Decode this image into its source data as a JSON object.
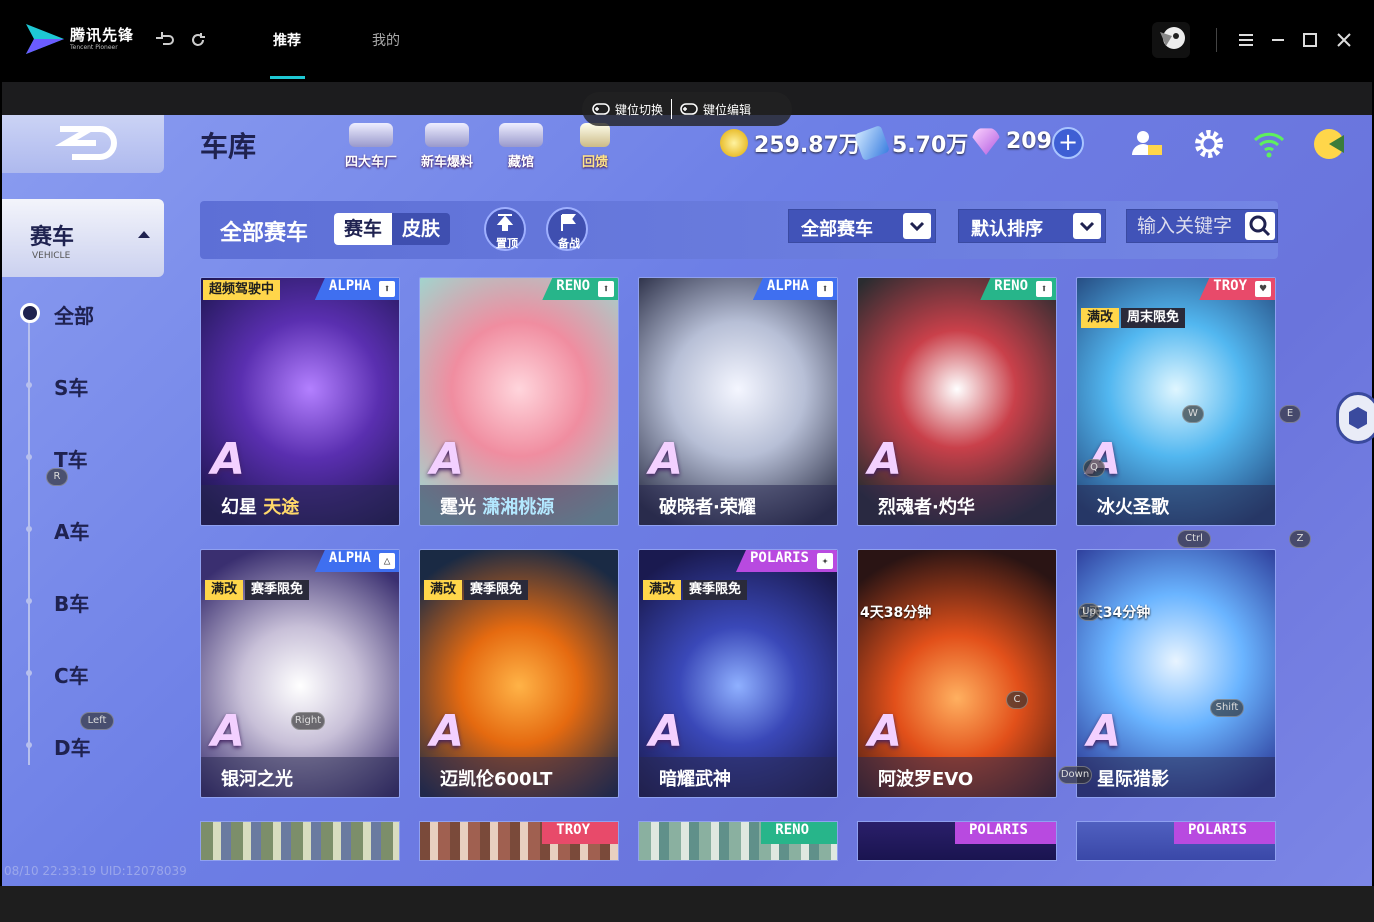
{
  "app": {
    "logo_cn": "腾讯先锋",
    "logo_en": "Tencent Pioneer",
    "tabs": [
      {
        "label": "推荐",
        "active": true
      },
      {
        "label": "我的",
        "active": false
      }
    ]
  },
  "keybar": {
    "switch_label": "键位切换",
    "edit_label": "键位编辑"
  },
  "game": {
    "title": "车库",
    "nav": [
      {
        "label": "四大车厂",
        "icon": "factory-icon"
      },
      {
        "label": "新车爆料",
        "icon": "new-car-icon"
      },
      {
        "label": "藏馆",
        "icon": "museum-icon"
      },
      {
        "label": "回馈",
        "icon": "gift-icon"
      }
    ],
    "currency": {
      "coins": "259.87万",
      "tickets": "5.70万",
      "gems": "209"
    },
    "sidebar": {
      "category_cn": "赛车",
      "category_en": "VEHICLE",
      "items": [
        {
          "label": "全部",
          "active": true
        },
        {
          "label": "S车"
        },
        {
          "label": "T车"
        },
        {
          "label": "A车"
        },
        {
          "label": "B车"
        },
        {
          "label": "C车"
        },
        {
          "label": "D车"
        }
      ]
    },
    "filter": {
      "title": "全部赛车",
      "seg_on": "赛车",
      "seg_off": "皮肤",
      "pin_label": "置顶",
      "backup_label": "备战",
      "dropdown_type": "全部赛车",
      "dropdown_sort": "默认排序",
      "search_placeholder": "输入关键字"
    },
    "cards": [
      {
        "name": "幻星",
        "name_hl": "天途",
        "class": "ALPHA",
        "grade": "A",
        "tag_top": "超频驾驶中",
        "theme": "purple"
      },
      {
        "name": "霆光",
        "name_hl2": "潇湘桃源",
        "class": "RENO",
        "grade": "A",
        "theme": "pink"
      },
      {
        "name": "破晓者·荣耀",
        "class": "ALPHA",
        "grade": "A",
        "theme": "white"
      },
      {
        "name": "烈魂者·灼华",
        "class": "RENO",
        "grade": "A",
        "theme": "red"
      },
      {
        "name": "冰火圣歌",
        "class": "TROY",
        "grade": "A",
        "tags": [
          "满改",
          "周末限免"
        ],
        "theme": "cyan"
      },
      {
        "name": "银河之光",
        "class": "ALPHA",
        "grade": "A",
        "tags": [
          "满改",
          "赛季限免"
        ],
        "theme": "silver"
      },
      {
        "name": "迈凯伦600LT",
        "grade": "A",
        "tags": [
          "满改",
          "赛季限免"
        ],
        "theme": "orange"
      },
      {
        "name": "暗耀武神",
        "class": "POLARIS",
        "grade": "A",
        "tags": [
          "满改",
          "赛季限免"
        ],
        "theme": "blue"
      },
      {
        "name": "阿波罗EVO",
        "grade": "A",
        "timer": "4天38分钟",
        "theme": "flame"
      },
      {
        "name": "星际猎影",
        "grade": "A",
        "timer": "1天34分钟",
        "theme": "robot"
      }
    ],
    "partial_cards": [
      {
        "class": ""
      },
      {
        "class": "TROY"
      },
      {
        "class": "RENO"
      },
      {
        "class": "POLARIS"
      },
      {
        "class": "POLARIS"
      }
    ],
    "watermark": "08/10 22:33:19 UID:12078039"
  },
  "keyhints": [
    "R",
    "W",
    "E",
    "Q",
    "Ctrl",
    "Z",
    "Right",
    "Left",
    "Up",
    "C",
    "Shift",
    "Down"
  ],
  "colors": {
    "accent": "#1ec8d4",
    "bg": "#6d7fe6",
    "panel": "#4153b8",
    "gold": "#ffd64a"
  }
}
